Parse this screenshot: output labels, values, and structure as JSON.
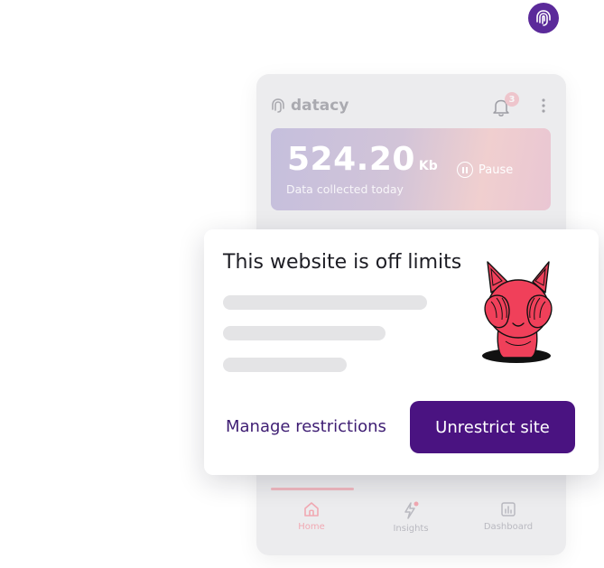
{
  "corner_logo": {
    "icon": "fingerprint-icon",
    "color": "#5b2a9a"
  },
  "app": {
    "brand": "datacy",
    "notification_count": "3",
    "data_value": "524.20",
    "data_unit": "Kb",
    "data_caption": "Data collected today",
    "pause_label": "Pause"
  },
  "nav": {
    "items": [
      {
        "label": "Home",
        "icon": "home-icon",
        "active": true
      },
      {
        "label": "Insights",
        "icon": "lightning-icon",
        "active": false
      },
      {
        "label": "Dashboard",
        "icon": "chart-icon",
        "active": false
      }
    ]
  },
  "dialog": {
    "title": "This website is off limits",
    "manage_label": "Manage restrictions",
    "unrestrict_label": "Unrestrict site",
    "mascot": "covering-eyes-mascot"
  },
  "colors": {
    "primary": "#4a1381",
    "accent_pink": "#f0405a",
    "link": "#3e1d73"
  }
}
